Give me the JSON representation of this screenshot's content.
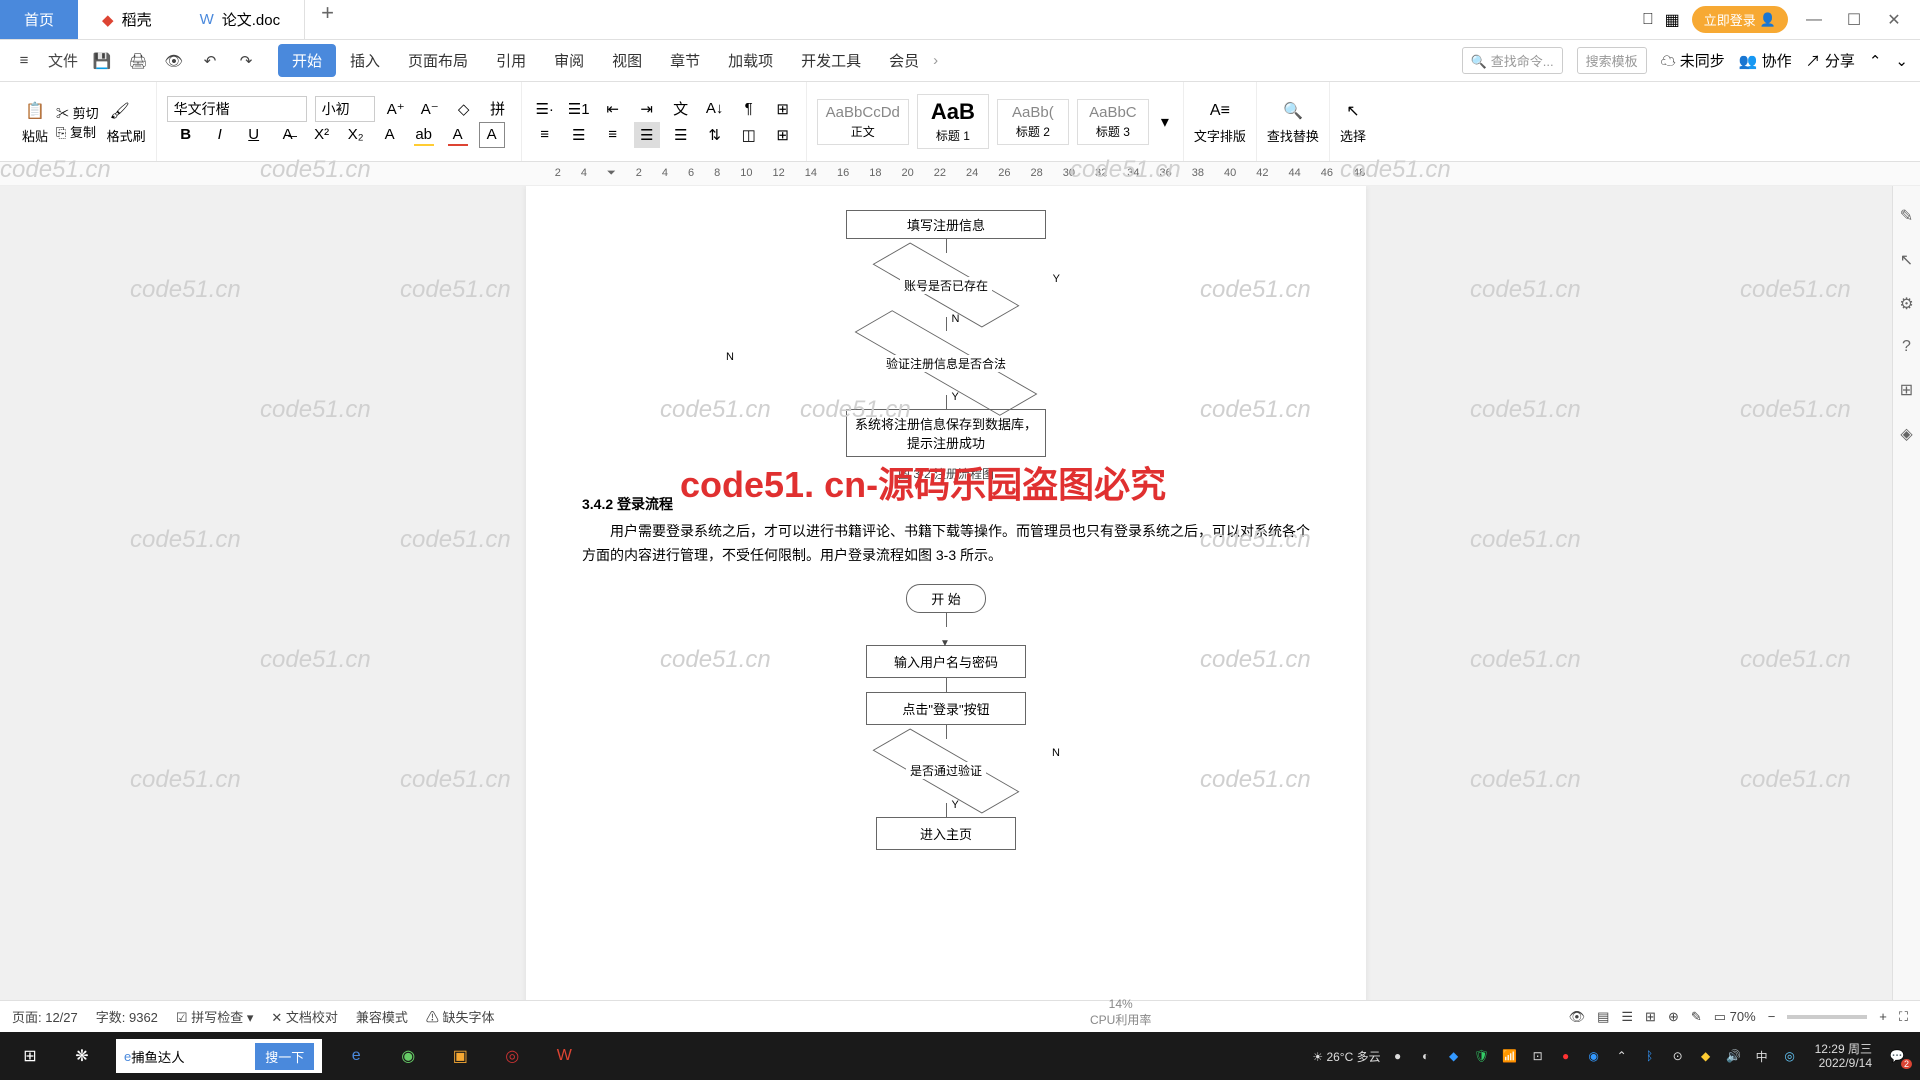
{
  "titlebar": {
    "tabs": {
      "home": "首页",
      "docer": "稻壳",
      "doc": "论文.doc"
    },
    "login": "立即登录"
  },
  "menubar": {
    "file": "文件",
    "items": [
      "开始",
      "插入",
      "页面布局",
      "引用",
      "审阅",
      "视图",
      "章节",
      "加载项",
      "开发工具",
      "会员"
    ],
    "search_cmd": "查找命令...",
    "search_tpl": "搜索模板",
    "sync": "未同步",
    "coop": "协作",
    "share": "分享"
  },
  "ribbon": {
    "paste": "粘贴",
    "cut": "剪切",
    "copy": "复制",
    "format_painter": "格式刷",
    "font_name": "华文行楷",
    "font_size": "小初",
    "styles": [
      {
        "preview": "AaBbCcDd",
        "name": "正文"
      },
      {
        "preview": "AaB",
        "name": "标题 1"
      },
      {
        "preview": "AaBb(",
        "name": "标题 2"
      },
      {
        "preview": "AaBbC",
        "name": "标题 3"
      }
    ],
    "text_layout": "文字排版",
    "find_replace": "查找替换",
    "select": "选择"
  },
  "ruler_marks": [
    "2",
    "4",
    "2",
    "4",
    "6",
    "8",
    "10",
    "12",
    "14",
    "16",
    "18",
    "20",
    "22",
    "24",
    "26",
    "28",
    "30",
    "32",
    "34",
    "36",
    "38",
    "40",
    "42",
    "44",
    "46",
    "48"
  ],
  "document": {
    "flow1": {
      "box1": "填写注册信息",
      "diamond1": "账号是否已存在",
      "diamond2": "验证注册信息是否合法",
      "box2": "系统将注册信息保存到数据库，提示注册成功",
      "y": "Y",
      "n": "N"
    },
    "caption1": "图 3-2   注册流程图",
    "section": "3.4.2  登录流程",
    "body": "用户需要登录系统之后，才可以进行书籍评论、书籍下载等操作。而管理员也只有登录系统之后，可以对系统各个方面的内容进行管理，不受任何限制。用户登录流程如图 3-3 所示。",
    "flow2": {
      "start": "开 始",
      "box1": "输入用户名与密码",
      "box2": "点击\"登录\"按钮",
      "diamond": "是否通过验证",
      "box3": "进入主页",
      "y": "Y",
      "n": "N"
    },
    "watermark_text": "code51.cn",
    "watermark_red": "code51. cn-源码乐园盗图必究"
  },
  "statusbar": {
    "page": "页面: 12/27",
    "words": "字数: 9362",
    "spell": "拼写检查",
    "docproof": "文档校对",
    "compat": "兼容模式",
    "missing_font": "缺失字体",
    "zoom": "70%"
  },
  "taskbar": {
    "search_value": "捕鱼达人",
    "search_btn": "搜一下",
    "weather_temp": "26°C",
    "weather_text": "多云",
    "cpu_pct": "14%",
    "cpu_label": "CPU利用率",
    "ime": "中",
    "time": "12:29",
    "day": "周三",
    "date": "2022/9/14",
    "notif_count": "2"
  }
}
